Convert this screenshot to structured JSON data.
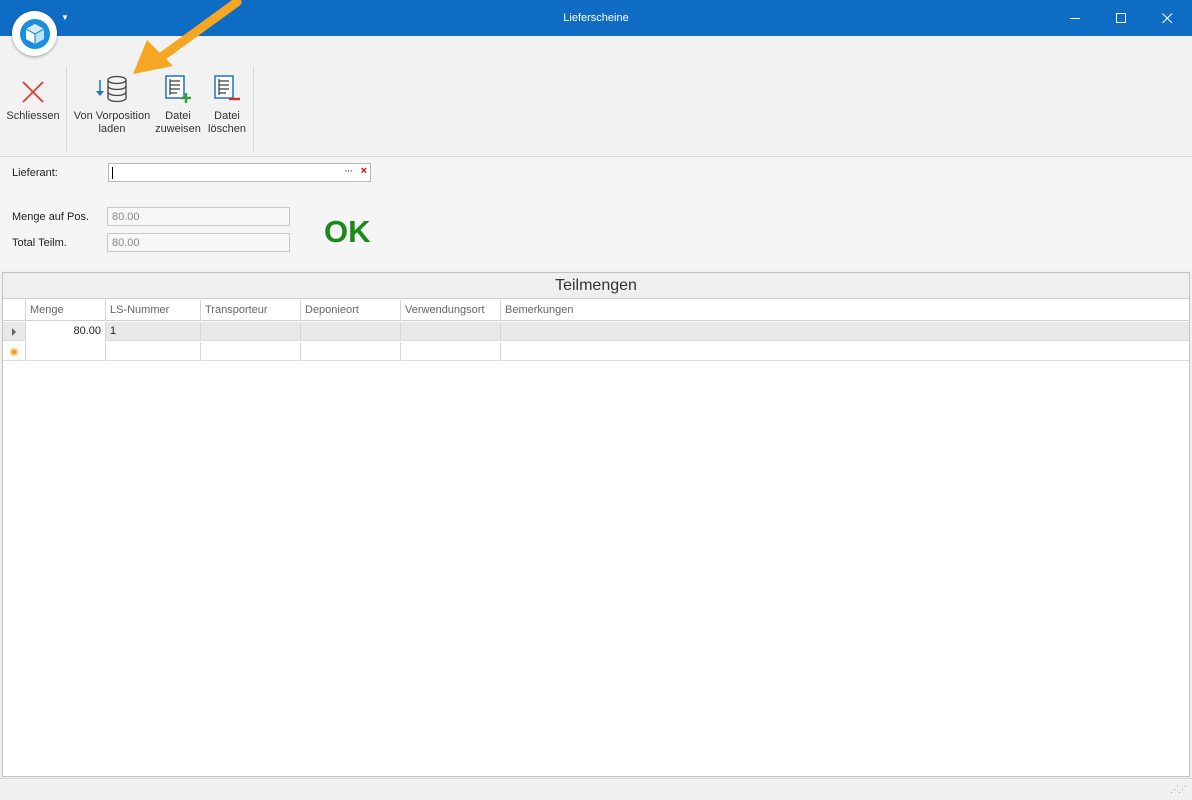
{
  "window": {
    "title": "Lieferscheine"
  },
  "ribbon": {
    "buttons": [
      {
        "label": "Schliessen",
        "icon": "close-x-icon"
      },
      {
        "label": "Von Vorposition\nladen",
        "icon": "database-load-icon"
      },
      {
        "label": "Datei\nzuweisen",
        "icon": "file-add-icon"
      },
      {
        "label": "Datei\nlöschen",
        "icon": "file-delete-icon"
      }
    ]
  },
  "form": {
    "lieferant_label": "Lieferant:",
    "lieferant_value": "",
    "menge_label": "Menge auf Pos.",
    "menge_value": "80.00",
    "total_label": "Total Teilm.",
    "total_value": "80.00",
    "status_text": "OK",
    "status_color": "#1b8a1b"
  },
  "grid": {
    "title": "Teilmengen",
    "columns": [
      "Menge",
      "LS-Nummer",
      "Transporteur",
      "Deponieort",
      "Verwendungsort",
      "Bemerkungen"
    ],
    "rows": [
      {
        "menge": "80.00",
        "ls_nummer": "1",
        "transporteur": "",
        "deponieort": "",
        "verwendungsort": "",
        "bemerkungen": ""
      }
    ]
  },
  "colors": {
    "titlebar": "#0f6cc4",
    "accent_arrow": "#f5a623",
    "close_icon": "#e53935",
    "icon_blue": "#1a73c8",
    "icon_green": "#2e9e3e",
    "icon_red": "#d32f2f"
  }
}
